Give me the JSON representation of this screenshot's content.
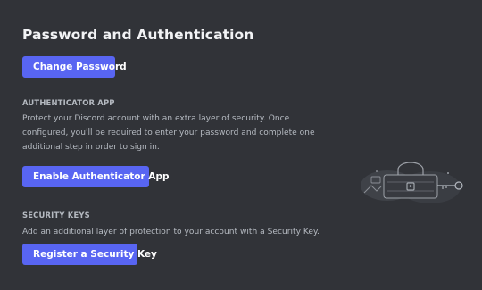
{
  "page": {
    "title": "Password and Authentication"
  },
  "password": {
    "change_button": "Change Password"
  },
  "authenticator": {
    "heading": "AUTHENTICATOR APP",
    "description": "Protect your Discord account with an extra layer of security. Once configured, you'll be required to enter your password and complete one additional step in order to sign in.",
    "enable_button": "Enable Authenticator App"
  },
  "security_keys": {
    "heading": "SECURITY KEYS",
    "description": "Add an additional layer of protection to your account with a Security Key.",
    "register_button": "Register a Security Key"
  },
  "illustration": {
    "icon": "lock-and-key-illustration"
  },
  "colors": {
    "background": "#313338",
    "accent": "#5865f2",
    "heading": "#f2f3f5",
    "muted_text": "#b5bac1"
  }
}
